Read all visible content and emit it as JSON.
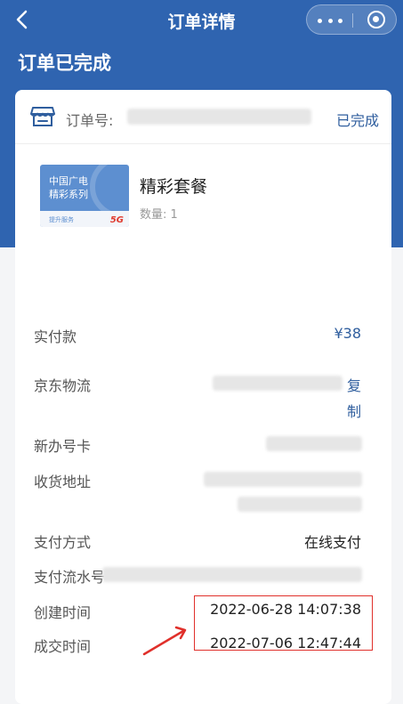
{
  "nav": {
    "title": "订单详情"
  },
  "status": {
    "title": "订单已完成"
  },
  "order": {
    "label": "订单号:",
    "status": "已完成"
  },
  "product": {
    "name": "精彩套餐",
    "quantity": "数量: 1",
    "image": {
      "line1": "中国广电",
      "line2": "精彩系列",
      "line3": "提升服务",
      "badge": "5G"
    }
  },
  "details": {
    "paid_label": "实付款",
    "paid_value": "¥38",
    "logistics_label": "京东物流",
    "logistics_copy_1": "复",
    "logistics_copy_2": "制",
    "new_card_label": "新办号卡",
    "address_label": "收货地址",
    "payment_method_label": "支付方式",
    "payment_method_value": "在线支付",
    "payment_serial_label": "支付流水号",
    "created_label": "创建时间",
    "created_value": "2022-06-28 14:07:38",
    "completed_label": "成交时间",
    "completed_value": "2022-07-06 12:47:44"
  },
  "colors": {
    "header": "#2f64b0",
    "accent": "#2f5e9e",
    "annotation": "#e0302b"
  }
}
